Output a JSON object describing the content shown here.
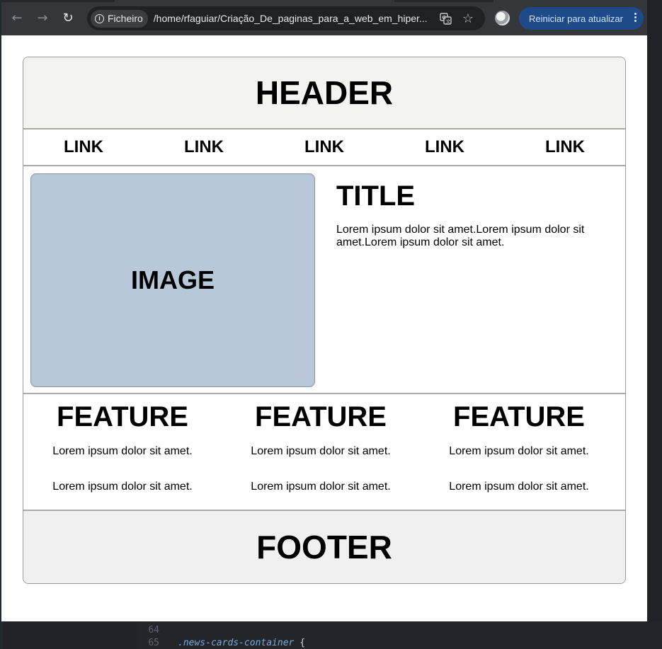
{
  "browser": {
    "security_chip": "Ficheiro",
    "url": "/home/rfaguiar/Criação_De_paginas_para_a_web_em_hiper...",
    "update_button": "Reiniciar para atualizar",
    "back_icon": "←",
    "forward_icon": "→",
    "reload_icon": "↻",
    "translate_icon": "translate-icon",
    "star_icon": "☆"
  },
  "page": {
    "header": "HEADER",
    "nav_links": [
      "LINK",
      "LINK",
      "LINK",
      "LINK",
      "LINK"
    ],
    "image_label": "IMAGE",
    "title": "TITLE",
    "body_text": "Lorem ipsum dolor sit amet.Lorem ipsum dolor sit amet.Lorem ipsum dolor sit amet.",
    "features": [
      {
        "title": "FEATURE",
        "text1": "Lorem ipsum dolor sit amet.",
        "text2": "Lorem ipsum dolor sit amet."
      },
      {
        "title": "FEATURE",
        "text1": "Lorem ipsum dolor sit amet.",
        "text2": "Lorem ipsum dolor sit amet."
      },
      {
        "title": "FEATURE",
        "text1": "Lorem ipsum dolor sit amet.",
        "text2": "Lorem ipsum dolor sit amet."
      }
    ],
    "footer": "FOOTER"
  },
  "editor": {
    "lines": [
      {
        "num": "64",
        "code": ""
      },
      {
        "num": "65",
        "code": ".news-cards-container",
        "brace": " {"
      }
    ]
  },
  "colors": {
    "toolbar": "#35363a",
    "update_button": "#1f4a8a",
    "image_box": "#b8c7d9",
    "header_bg": "#f3f3f1"
  }
}
